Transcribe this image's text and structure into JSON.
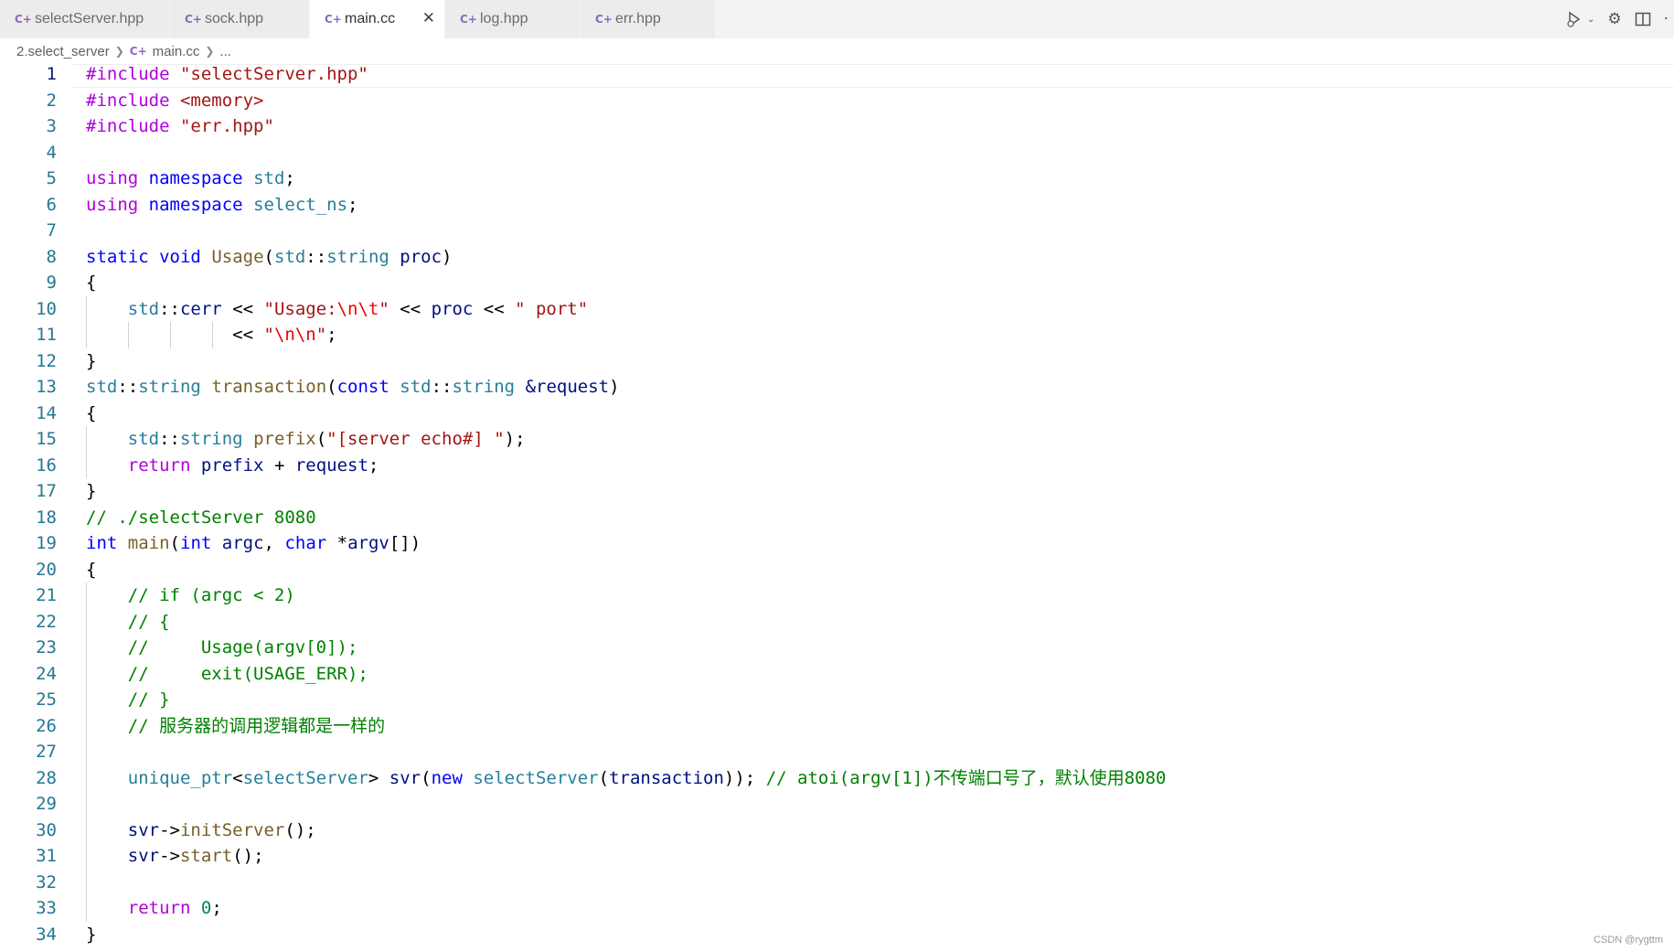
{
  "tabs": [
    {
      "label": "selectServer.hpp",
      "icon": "cpp-file-icon",
      "active": false
    },
    {
      "label": "sock.hpp",
      "icon": "cpp-file-icon",
      "active": false
    },
    {
      "label": "main.cc",
      "icon": "cpp-file-icon",
      "active": true
    },
    {
      "label": "log.hpp",
      "icon": "cpp-file-icon",
      "active": false
    },
    {
      "label": "err.hpp",
      "icon": "cpp-file-icon",
      "active": false
    }
  ],
  "tab_actions": [
    "run-debug-icon",
    "settings-gear-icon",
    "split-editor-icon",
    "more-actions-icon"
  ],
  "breadcrumb": {
    "folder": "2.select_server",
    "file": "main.cc",
    "ellipsis": "..."
  },
  "editor": {
    "current_line": 1,
    "line_numbers": [
      "1",
      "2",
      "3",
      "4",
      "5",
      "6",
      "7",
      "8",
      "9",
      "10",
      "11",
      "12",
      "13",
      "14",
      "15",
      "16",
      "17",
      "18",
      "19",
      "20",
      "21",
      "22",
      "23",
      "24",
      "25",
      "26",
      "27",
      "28",
      "29",
      "30",
      "31",
      "32",
      "33",
      "34"
    ],
    "lines": [
      [
        {
          "t": "#include ",
          "c": "pp"
        },
        {
          "t": "\"selectServer.hpp\"",
          "c": "str"
        }
      ],
      [
        {
          "t": "#include ",
          "c": "pp"
        },
        {
          "t": "<memory>",
          "c": "str"
        }
      ],
      [
        {
          "t": "#include ",
          "c": "pp"
        },
        {
          "t": "\"err.hpp\"",
          "c": "str"
        }
      ],
      [],
      [
        {
          "t": "using",
          "c": "ctl"
        },
        {
          "t": " ",
          "c": "op"
        },
        {
          "t": "namespace",
          "c": "kw"
        },
        {
          "t": " ",
          "c": "op"
        },
        {
          "t": "std",
          "c": "ns"
        },
        {
          "t": ";",
          "c": "op"
        }
      ],
      [
        {
          "t": "using",
          "c": "ctl"
        },
        {
          "t": " ",
          "c": "op"
        },
        {
          "t": "namespace",
          "c": "kw"
        },
        {
          "t": " ",
          "c": "op"
        },
        {
          "t": "select_ns",
          "c": "ns"
        },
        {
          "t": ";",
          "c": "op"
        }
      ],
      [],
      [
        {
          "t": "static",
          "c": "kw"
        },
        {
          "t": " ",
          "c": "op"
        },
        {
          "t": "void",
          "c": "kw"
        },
        {
          "t": " ",
          "c": "op"
        },
        {
          "t": "Usage",
          "c": "fn"
        },
        {
          "t": "(",
          "c": "op"
        },
        {
          "t": "std",
          "c": "ns"
        },
        {
          "t": "::",
          "c": "op"
        },
        {
          "t": "string",
          "c": "type"
        },
        {
          "t": " ",
          "c": "op"
        },
        {
          "t": "proc",
          "c": "var"
        },
        {
          "t": ")",
          "c": "op"
        }
      ],
      [
        {
          "t": "{",
          "c": "op"
        }
      ],
      [
        {
          "t": "    ",
          "c": "op"
        },
        {
          "t": "std",
          "c": "ns"
        },
        {
          "t": "::",
          "c": "op"
        },
        {
          "t": "cerr",
          "c": "var"
        },
        {
          "t": " << ",
          "c": "op"
        },
        {
          "t": "\"Usage:",
          "c": "str"
        },
        {
          "t": "\\n\\t",
          "c": "esc"
        },
        {
          "t": "\"",
          "c": "str"
        },
        {
          "t": " << ",
          "c": "op"
        },
        {
          "t": "proc",
          "c": "var"
        },
        {
          "t": " << ",
          "c": "op"
        },
        {
          "t": "\" port\"",
          "c": "str"
        }
      ],
      [
        {
          "t": "              ",
          "c": "op"
        },
        {
          "t": "<< ",
          "c": "op"
        },
        {
          "t": "\"",
          "c": "str"
        },
        {
          "t": "\\n\\n",
          "c": "esc"
        },
        {
          "t": "\"",
          "c": "str"
        },
        {
          "t": ";",
          "c": "op"
        }
      ],
      [
        {
          "t": "}",
          "c": "op"
        }
      ],
      [
        {
          "t": "std",
          "c": "ns"
        },
        {
          "t": "::",
          "c": "op"
        },
        {
          "t": "string",
          "c": "type"
        },
        {
          "t": " ",
          "c": "op"
        },
        {
          "t": "transaction",
          "c": "fn"
        },
        {
          "t": "(",
          "c": "op"
        },
        {
          "t": "const",
          "c": "kw"
        },
        {
          "t": " ",
          "c": "op"
        },
        {
          "t": "std",
          "c": "ns"
        },
        {
          "t": "::",
          "c": "op"
        },
        {
          "t": "string",
          "c": "type"
        },
        {
          "t": " ",
          "c": "op"
        },
        {
          "t": "&request",
          "c": "var"
        },
        {
          "t": ")",
          "c": "op"
        }
      ],
      [
        {
          "t": "{",
          "c": "op"
        }
      ],
      [
        {
          "t": "    ",
          "c": "op"
        },
        {
          "t": "std",
          "c": "ns"
        },
        {
          "t": "::",
          "c": "op"
        },
        {
          "t": "string",
          "c": "type"
        },
        {
          "t": " ",
          "c": "op"
        },
        {
          "t": "prefix",
          "c": "fn"
        },
        {
          "t": "(",
          "c": "op"
        },
        {
          "t": "\"[server echo#] \"",
          "c": "str"
        },
        {
          "t": ");",
          "c": "op"
        }
      ],
      [
        {
          "t": "    ",
          "c": "op"
        },
        {
          "t": "return",
          "c": "ctl"
        },
        {
          "t": " ",
          "c": "op"
        },
        {
          "t": "prefix",
          "c": "var"
        },
        {
          "t": " + ",
          "c": "op"
        },
        {
          "t": "request",
          "c": "var"
        },
        {
          "t": ";",
          "c": "op"
        }
      ],
      [
        {
          "t": "}",
          "c": "op"
        }
      ],
      [
        {
          "t": "// ./selectServer 8080",
          "c": "cmt"
        }
      ],
      [
        {
          "t": "int",
          "c": "kw"
        },
        {
          "t": " ",
          "c": "op"
        },
        {
          "t": "main",
          "c": "fn"
        },
        {
          "t": "(",
          "c": "op"
        },
        {
          "t": "int",
          "c": "kw"
        },
        {
          "t": " ",
          "c": "op"
        },
        {
          "t": "argc",
          "c": "var"
        },
        {
          "t": ", ",
          "c": "op"
        },
        {
          "t": "char",
          "c": "kw"
        },
        {
          "t": " *",
          "c": "op"
        },
        {
          "t": "argv",
          "c": "var"
        },
        {
          "t": "[])",
          "c": "op"
        }
      ],
      [
        {
          "t": "{",
          "c": "op"
        }
      ],
      [
        {
          "t": "    ",
          "c": "op"
        },
        {
          "t": "// if (argc < 2)",
          "c": "cmt"
        }
      ],
      [
        {
          "t": "    ",
          "c": "op"
        },
        {
          "t": "// {",
          "c": "cmt"
        }
      ],
      [
        {
          "t": "    ",
          "c": "op"
        },
        {
          "t": "//     Usage(argv[0]);",
          "c": "cmt"
        }
      ],
      [
        {
          "t": "    ",
          "c": "op"
        },
        {
          "t": "//     exit(USAGE_ERR);",
          "c": "cmt"
        }
      ],
      [
        {
          "t": "    ",
          "c": "op"
        },
        {
          "t": "// }",
          "c": "cmt"
        }
      ],
      [
        {
          "t": "    ",
          "c": "op"
        },
        {
          "t": "// 服务器的调用逻辑都是一样的",
          "c": "cmt"
        }
      ],
      [],
      [
        {
          "t": "    ",
          "c": "op"
        },
        {
          "t": "unique_ptr",
          "c": "type"
        },
        {
          "t": "<",
          "c": "op"
        },
        {
          "t": "selectServer",
          "c": "type"
        },
        {
          "t": "> ",
          "c": "op"
        },
        {
          "t": "svr",
          "c": "var"
        },
        {
          "t": "(",
          "c": "op"
        },
        {
          "t": "new",
          "c": "kw"
        },
        {
          "t": " ",
          "c": "op"
        },
        {
          "t": "selectServer",
          "c": "type"
        },
        {
          "t": "(",
          "c": "op"
        },
        {
          "t": "transaction",
          "c": "var"
        },
        {
          "t": ")); ",
          "c": "op"
        },
        {
          "t": "// atoi(argv[1])不传端口号了，默认使用8080",
          "c": "cmt"
        }
      ],
      [],
      [
        {
          "t": "    ",
          "c": "op"
        },
        {
          "t": "svr",
          "c": "var"
        },
        {
          "t": "->",
          "c": "op"
        },
        {
          "t": "initServer",
          "c": "fn"
        },
        {
          "t": "();",
          "c": "op"
        }
      ],
      [
        {
          "t": "    ",
          "c": "op"
        },
        {
          "t": "svr",
          "c": "var"
        },
        {
          "t": "->",
          "c": "op"
        },
        {
          "t": "start",
          "c": "fn"
        },
        {
          "t": "();",
          "c": "op"
        }
      ],
      [],
      [
        {
          "t": "    ",
          "c": "op"
        },
        {
          "t": "return",
          "c": "ctl"
        },
        {
          "t": " ",
          "c": "op"
        },
        {
          "t": "0",
          "c": "num"
        },
        {
          "t": ";",
          "c": "op"
        }
      ],
      [
        {
          "t": "}",
          "c": "op"
        }
      ]
    ],
    "indent_guide_lines": [
      10,
      11,
      15,
      16,
      21,
      22,
      23,
      24,
      25,
      26,
      27,
      28,
      29,
      30,
      31,
      32,
      33
    ]
  },
  "watermark": "CSDN @rygttm",
  "colors": {
    "keyword": "#0000ff",
    "control": "#af00db",
    "string": "#a31515",
    "comment": "#008000",
    "type": "#267f99",
    "function": "#795e26",
    "variable": "#001080",
    "number": "#098658",
    "line_number": "#237893"
  }
}
